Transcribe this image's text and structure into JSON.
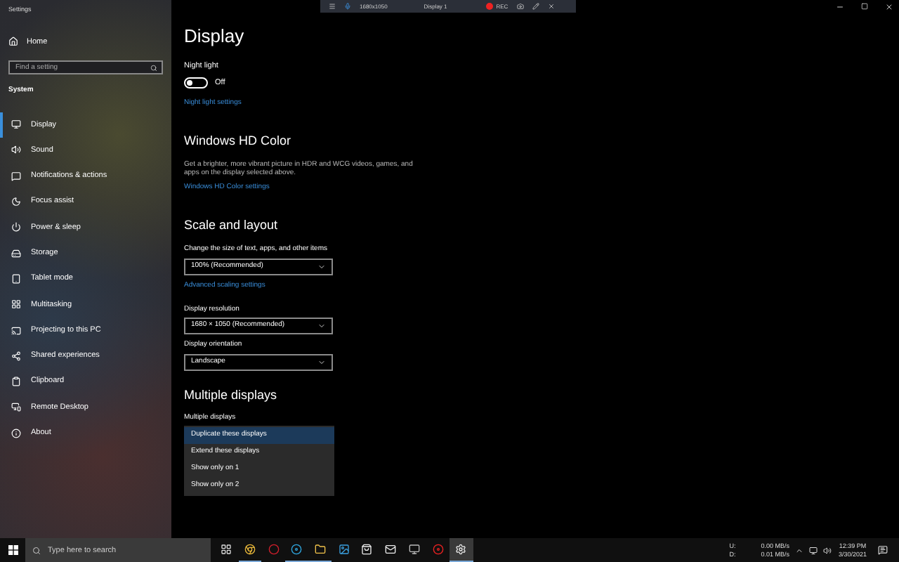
{
  "window": {
    "title": "Settings"
  },
  "recorder": {
    "resolution": "1680x1050",
    "display": "Display 1",
    "rec": "REC"
  },
  "sidebar": {
    "home": "Home",
    "search": {
      "placeholder": "Find a setting"
    },
    "section": "System",
    "items": [
      {
        "label": "Display",
        "selected": true
      },
      {
        "label": "Sound",
        "selected": false
      },
      {
        "label": "Notifications & actions",
        "selected": false
      },
      {
        "label": "Focus assist",
        "selected": false
      },
      {
        "label": "Power & sleep",
        "selected": false
      },
      {
        "label": "Storage",
        "selected": false
      },
      {
        "label": "Tablet mode",
        "selected": false
      },
      {
        "label": "Multitasking",
        "selected": false
      },
      {
        "label": "Projecting to this PC",
        "selected": false
      },
      {
        "label": "Shared experiences",
        "selected": false
      },
      {
        "label": "Clipboard",
        "selected": false
      },
      {
        "label": "Remote Desktop",
        "selected": false
      },
      {
        "label": "About",
        "selected": false
      }
    ]
  },
  "main": {
    "title": "Display",
    "night_light": {
      "label": "Night light",
      "on": false,
      "state_text": "Off",
      "link": "Night light settings"
    },
    "hd_color": {
      "heading": "Windows HD Color",
      "description": "Get a brighter, more vibrant picture in HDR and WCG videos, games, and apps on the display selected above.",
      "link": "Windows HD Color settings"
    },
    "scale": {
      "heading": "Scale and layout",
      "size_label": "Change the size of text, apps, and other items",
      "size_value": "100% (Recommended)",
      "link": "Advanced scaling settings",
      "resolution_label": "Display resolution",
      "resolution_value": "1680 × 1050 (Recommended)",
      "orientation_label": "Display orientation",
      "orientation_value": "Landscape"
    },
    "multiple": {
      "heading": "Multiple displays",
      "label": "Multiple displays",
      "options": [
        {
          "label": "Duplicate these displays",
          "selected": true
        },
        {
          "label": "Extend these displays",
          "selected": false
        },
        {
          "label": "Show only on 1",
          "selected": false
        },
        {
          "label": "Show only on 2",
          "selected": false
        }
      ]
    }
  },
  "taskbar": {
    "search": {
      "placeholder": "Type here to search"
    },
    "apps": [
      {
        "running": false,
        "selected": false
      },
      {
        "running": true,
        "selected": false
      },
      {
        "running": false,
        "selected": false
      },
      {
        "running": true,
        "selected": false
      },
      {
        "running": true,
        "selected": false
      },
      {
        "running": false,
        "selected": false
      },
      {
        "running": false,
        "selected": false
      },
      {
        "running": false,
        "selected": false
      },
      {
        "running": false,
        "selected": false
      },
      {
        "running": false,
        "selected": false
      },
      {
        "running": true,
        "selected": true
      }
    ],
    "network": {
      "up_label": "U:",
      "up": "0.00 MB/s",
      "down_label": "D:",
      "down": "0.01 MB/s"
    },
    "time": "12:39 PM",
    "date": "3/30/2021"
  }
}
